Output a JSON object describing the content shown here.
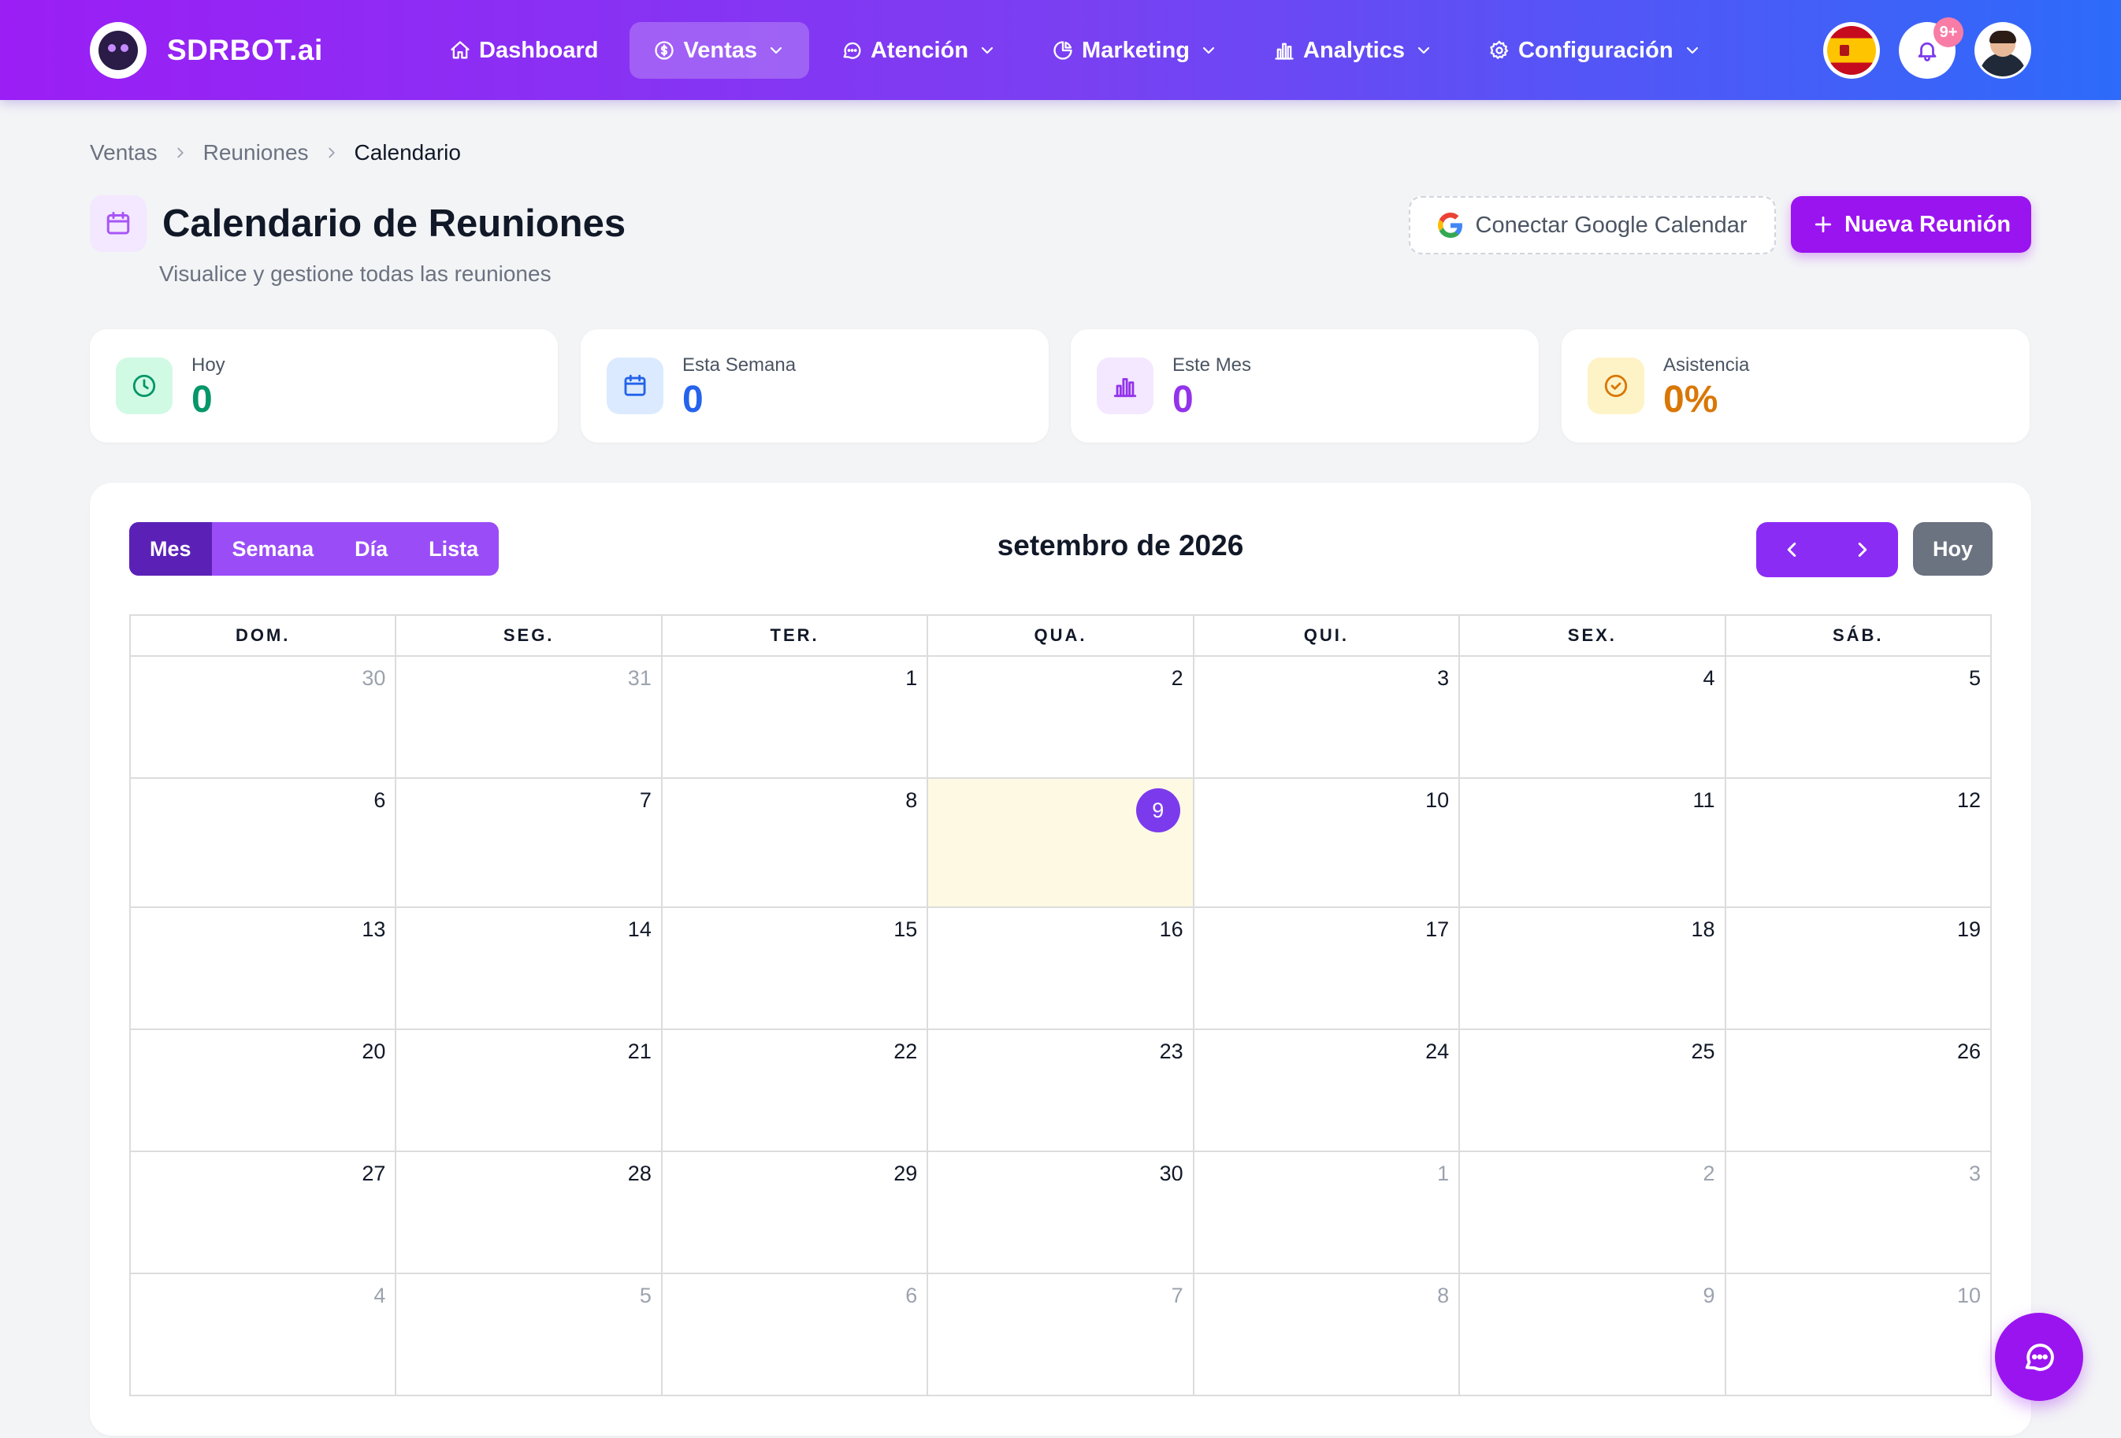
{
  "brand": {
    "name": "SDRBOT.ai"
  },
  "nav": {
    "items": [
      {
        "label": "Dashboard",
        "icon": "home-icon",
        "active": false,
        "dropdown": false
      },
      {
        "label": "Ventas",
        "icon": "dollar-icon",
        "active": true,
        "dropdown": true
      },
      {
        "label": "Atención",
        "icon": "chat-icon",
        "active": false,
        "dropdown": true
      },
      {
        "label": "Marketing",
        "icon": "pie-chart-icon",
        "active": false,
        "dropdown": true
      },
      {
        "label": "Analytics",
        "icon": "bar-chart-icon",
        "active": false,
        "dropdown": true
      },
      {
        "label": "Configuración",
        "icon": "gear-icon",
        "active": false,
        "dropdown": true
      }
    ],
    "notifications_badge": "9+"
  },
  "breadcrumb": {
    "items": [
      "Ventas",
      "Reuniones"
    ],
    "current": "Calendario"
  },
  "header": {
    "title": "Calendario de Reuniones",
    "subtitle": "Visualice y gestione todas las reuniones",
    "google_button": "Conectar Google Calendar",
    "new_button": "Nueva Reunión"
  },
  "stats": [
    {
      "label": "Hoy",
      "value": "0",
      "color": "#059669",
      "bg": "#d1fae5",
      "icon": "clock-icon"
    },
    {
      "label": "Esta Semana",
      "value": "0",
      "color": "#2563eb",
      "bg": "#dbeafe",
      "icon": "calendar-icon"
    },
    {
      "label": "Este Mes",
      "value": "0",
      "color": "#9333ea",
      "bg": "#f3e8ff",
      "icon": "bar-chart-icon"
    },
    {
      "label": "Asistencia",
      "value": "0%",
      "color": "#d97706",
      "bg": "#fef3c7",
      "icon": "check-circle-icon"
    }
  ],
  "calendar": {
    "views": [
      "Mes",
      "Semana",
      "Día",
      "Lista"
    ],
    "active_view": "Mes",
    "title": "setembro de 2026",
    "today_button": "Hoy",
    "weekdays": [
      "DOM.",
      "SEG.",
      "TER.",
      "QUA.",
      "QUI.",
      "SEX.",
      "SÁB."
    ],
    "today": "9",
    "weeks": [
      [
        {
          "d": "30",
          "o": true
        },
        {
          "d": "31",
          "o": true
        },
        {
          "d": "1"
        },
        {
          "d": "2"
        },
        {
          "d": "3"
        },
        {
          "d": "4"
        },
        {
          "d": "5"
        }
      ],
      [
        {
          "d": "6"
        },
        {
          "d": "7"
        },
        {
          "d": "8"
        },
        {
          "d": "9",
          "t": true
        },
        {
          "d": "10"
        },
        {
          "d": "11"
        },
        {
          "d": "12"
        }
      ],
      [
        {
          "d": "13"
        },
        {
          "d": "14"
        },
        {
          "d": "15"
        },
        {
          "d": "16"
        },
        {
          "d": "17"
        },
        {
          "d": "18"
        },
        {
          "d": "19"
        }
      ],
      [
        {
          "d": "20"
        },
        {
          "d": "21"
        },
        {
          "d": "22"
        },
        {
          "d": "23"
        },
        {
          "d": "24"
        },
        {
          "d": "25"
        },
        {
          "d": "26"
        }
      ],
      [
        {
          "d": "27"
        },
        {
          "d": "28"
        },
        {
          "d": "29"
        },
        {
          "d": "30"
        },
        {
          "d": "1",
          "o": true
        },
        {
          "d": "2",
          "o": true
        },
        {
          "d": "3",
          "o": true
        }
      ],
      [
        {
          "d": "4",
          "o": true
        },
        {
          "d": "5",
          "o": true
        },
        {
          "d": "6",
          "o": true
        },
        {
          "d": "7",
          "o": true
        },
        {
          "d": "8",
          "o": true
        },
        {
          "d": "9",
          "o": true
        },
        {
          "d": "10",
          "o": true
        }
      ]
    ]
  },
  "colors": {
    "accent": "#9a14f0",
    "today_bg": "#fef9e3",
    "today_badge": "#7c3aed"
  }
}
